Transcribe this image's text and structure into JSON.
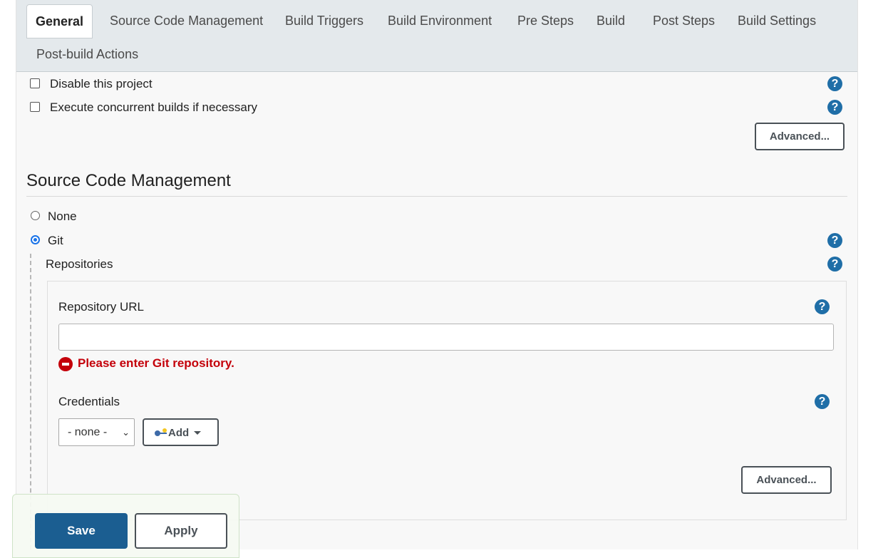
{
  "tabs": {
    "general": "General",
    "scm": "Source Code Management",
    "triggers": "Build Triggers",
    "environment": "Build Environment",
    "pre_steps": "Pre Steps",
    "build": "Build",
    "post_steps": "Post Steps",
    "settings": "Build Settings",
    "post_build": "Post-build Actions",
    "active": "General"
  },
  "general": {
    "disable_label": "Disable this project",
    "disable_checked": false,
    "concurrent_label": "Execute concurrent builds if necessary",
    "concurrent_checked": false,
    "advanced_label": "Advanced..."
  },
  "help_glyph": "?",
  "scm": {
    "title": "Source Code Management",
    "none_label": "None",
    "git_label": "Git",
    "selected": "Git",
    "repositories_label": "Repositories",
    "repo_url_label": "Repository URL",
    "repo_url_value": "",
    "error_text": "Please enter Git repository.",
    "credentials_label": "Credentials",
    "credentials_selected": "- none -",
    "add_label": "Add",
    "advanced_label": "Advanced..."
  },
  "footer": {
    "save_label": "Save",
    "apply_label": "Apply"
  },
  "colors": {
    "accent": "#1f6ea7",
    "save_button": "#1b5e91",
    "error": "#c4000a",
    "tabbar_bg": "#e4e9ec"
  },
  "icons": {
    "help": "help-icon",
    "error": "error-icon",
    "key": "key-icon",
    "dropdown": "caret-down-icon"
  }
}
